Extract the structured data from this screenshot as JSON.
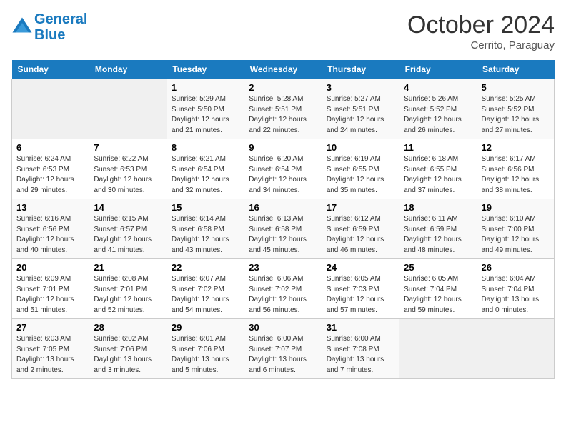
{
  "header": {
    "logo_line1": "General",
    "logo_line2": "Blue",
    "month": "October 2024",
    "location": "Cerrito, Paraguay"
  },
  "days_of_week": [
    "Sunday",
    "Monday",
    "Tuesday",
    "Wednesday",
    "Thursday",
    "Friday",
    "Saturday"
  ],
  "weeks": [
    [
      {
        "day": "",
        "info": ""
      },
      {
        "day": "",
        "info": ""
      },
      {
        "day": "1",
        "info": "Sunrise: 5:29 AM\nSunset: 5:50 PM\nDaylight: 12 hours and 21 minutes."
      },
      {
        "day": "2",
        "info": "Sunrise: 5:28 AM\nSunset: 5:51 PM\nDaylight: 12 hours and 22 minutes."
      },
      {
        "day": "3",
        "info": "Sunrise: 5:27 AM\nSunset: 5:51 PM\nDaylight: 12 hours and 24 minutes."
      },
      {
        "day": "4",
        "info": "Sunrise: 5:26 AM\nSunset: 5:52 PM\nDaylight: 12 hours and 26 minutes."
      },
      {
        "day": "5",
        "info": "Sunrise: 5:25 AM\nSunset: 5:52 PM\nDaylight: 12 hours and 27 minutes."
      }
    ],
    [
      {
        "day": "6",
        "info": "Sunrise: 6:24 AM\nSunset: 6:53 PM\nDaylight: 12 hours and 29 minutes."
      },
      {
        "day": "7",
        "info": "Sunrise: 6:22 AM\nSunset: 6:53 PM\nDaylight: 12 hours and 30 minutes."
      },
      {
        "day": "8",
        "info": "Sunrise: 6:21 AM\nSunset: 6:54 PM\nDaylight: 12 hours and 32 minutes."
      },
      {
        "day": "9",
        "info": "Sunrise: 6:20 AM\nSunset: 6:54 PM\nDaylight: 12 hours and 34 minutes."
      },
      {
        "day": "10",
        "info": "Sunrise: 6:19 AM\nSunset: 6:55 PM\nDaylight: 12 hours and 35 minutes."
      },
      {
        "day": "11",
        "info": "Sunrise: 6:18 AM\nSunset: 6:55 PM\nDaylight: 12 hours and 37 minutes."
      },
      {
        "day": "12",
        "info": "Sunrise: 6:17 AM\nSunset: 6:56 PM\nDaylight: 12 hours and 38 minutes."
      }
    ],
    [
      {
        "day": "13",
        "info": "Sunrise: 6:16 AM\nSunset: 6:56 PM\nDaylight: 12 hours and 40 minutes."
      },
      {
        "day": "14",
        "info": "Sunrise: 6:15 AM\nSunset: 6:57 PM\nDaylight: 12 hours and 41 minutes."
      },
      {
        "day": "15",
        "info": "Sunrise: 6:14 AM\nSunset: 6:58 PM\nDaylight: 12 hours and 43 minutes."
      },
      {
        "day": "16",
        "info": "Sunrise: 6:13 AM\nSunset: 6:58 PM\nDaylight: 12 hours and 45 minutes."
      },
      {
        "day": "17",
        "info": "Sunrise: 6:12 AM\nSunset: 6:59 PM\nDaylight: 12 hours and 46 minutes."
      },
      {
        "day": "18",
        "info": "Sunrise: 6:11 AM\nSunset: 6:59 PM\nDaylight: 12 hours and 48 minutes."
      },
      {
        "day": "19",
        "info": "Sunrise: 6:10 AM\nSunset: 7:00 PM\nDaylight: 12 hours and 49 minutes."
      }
    ],
    [
      {
        "day": "20",
        "info": "Sunrise: 6:09 AM\nSunset: 7:01 PM\nDaylight: 12 hours and 51 minutes."
      },
      {
        "day": "21",
        "info": "Sunrise: 6:08 AM\nSunset: 7:01 PM\nDaylight: 12 hours and 52 minutes."
      },
      {
        "day": "22",
        "info": "Sunrise: 6:07 AM\nSunset: 7:02 PM\nDaylight: 12 hours and 54 minutes."
      },
      {
        "day": "23",
        "info": "Sunrise: 6:06 AM\nSunset: 7:02 PM\nDaylight: 12 hours and 56 minutes."
      },
      {
        "day": "24",
        "info": "Sunrise: 6:05 AM\nSunset: 7:03 PM\nDaylight: 12 hours and 57 minutes."
      },
      {
        "day": "25",
        "info": "Sunrise: 6:05 AM\nSunset: 7:04 PM\nDaylight: 12 hours and 59 minutes."
      },
      {
        "day": "26",
        "info": "Sunrise: 6:04 AM\nSunset: 7:04 PM\nDaylight: 13 hours and 0 minutes."
      }
    ],
    [
      {
        "day": "27",
        "info": "Sunrise: 6:03 AM\nSunset: 7:05 PM\nDaylight: 13 hours and 2 minutes."
      },
      {
        "day": "28",
        "info": "Sunrise: 6:02 AM\nSunset: 7:06 PM\nDaylight: 13 hours and 3 minutes."
      },
      {
        "day": "29",
        "info": "Sunrise: 6:01 AM\nSunset: 7:06 PM\nDaylight: 13 hours and 5 minutes."
      },
      {
        "day": "30",
        "info": "Sunrise: 6:00 AM\nSunset: 7:07 PM\nDaylight: 13 hours and 6 minutes."
      },
      {
        "day": "31",
        "info": "Sunrise: 6:00 AM\nSunset: 7:08 PM\nDaylight: 13 hours and 7 minutes."
      },
      {
        "day": "",
        "info": ""
      },
      {
        "day": "",
        "info": ""
      }
    ]
  ]
}
